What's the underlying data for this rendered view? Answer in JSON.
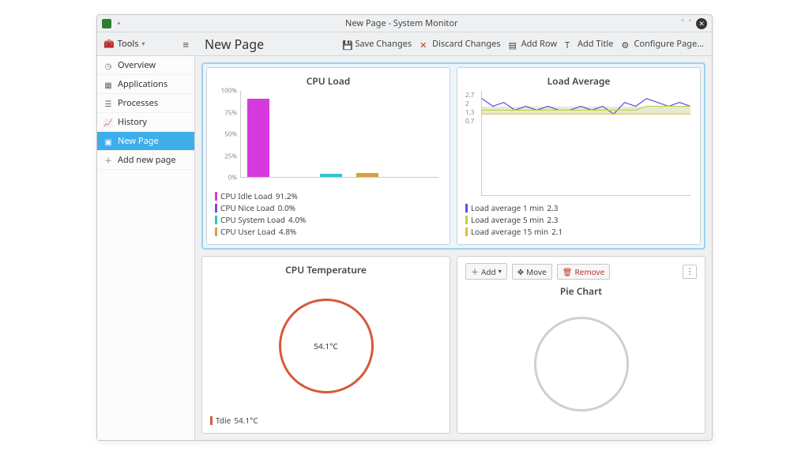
{
  "window": {
    "title": "New Page - System Monitor"
  },
  "sidebar_header": {
    "tools_label": "Tools"
  },
  "page_title": "New Page",
  "actions": {
    "save": "Save Changes",
    "discard": "Discard Changes",
    "add_row": "Add Row",
    "add_title": "Add Title",
    "configure": "Configure Page..."
  },
  "sidebar": {
    "items": [
      {
        "label": "Overview",
        "icon": "speedometer"
      },
      {
        "label": "Applications",
        "icon": "grid"
      },
      {
        "label": "Processes",
        "icon": "list"
      },
      {
        "label": "History",
        "icon": "chart"
      },
      {
        "label": "New Page",
        "icon": "page",
        "active": true
      },
      {
        "label": "Add new page",
        "icon": "plus"
      }
    ]
  },
  "panels": {
    "cpu_load": {
      "title": "CPU Load",
      "y_ticks": [
        "100%",
        "75%",
        "50%",
        "25%",
        "0%"
      ],
      "legend": [
        {
          "label": "CPU Idle Load",
          "value": "91.2%",
          "color": "#d63adf"
        },
        {
          "label": "CPU Nice Load",
          "value": "0.0%",
          "color": "#7a4bd6"
        },
        {
          "label": "CPU System Load",
          "value": "4.0%",
          "color": "#2fc7c7"
        },
        {
          "label": "CPU User Load",
          "value": "4.8%",
          "color": "#d6a23a"
        }
      ]
    },
    "load_avg": {
      "title": "Load Average",
      "y_ticks": [
        "2.7",
        "2",
        "1.3",
        "0.7"
      ],
      "legend": [
        {
          "label": "Load average 1 min",
          "value": "2.3",
          "color": "#6a4bd6"
        },
        {
          "label": "Load average 5 min",
          "value": "2.3",
          "color": "#b9d63a"
        },
        {
          "label": "Load average 15 min",
          "value": "2.1",
          "color": "#d6c23a"
        }
      ]
    },
    "cpu_temp": {
      "title": "CPU Temperature",
      "center_value": "54.1°C",
      "legend": [
        {
          "label": "Tdie",
          "value": "54.1°C",
          "color": "#d65a3a"
        }
      ]
    },
    "pie": {
      "title": "Pie Chart",
      "toolbar": {
        "add": "Add",
        "move": "Move",
        "remove": "Remove"
      }
    }
  },
  "chart_data": [
    {
      "type": "bar",
      "title": "CPU Load",
      "ylabel": "%",
      "ylim": [
        0,
        100
      ],
      "categories": [
        "CPU Idle Load",
        "CPU Nice Load",
        "CPU System Load",
        "CPU User Load"
      ],
      "values": [
        91.2,
        0.0,
        4.0,
        4.8
      ],
      "colors": [
        "#d63adf",
        "#7a4bd6",
        "#2fc7c7",
        "#d6a23a"
      ]
    },
    {
      "type": "line",
      "title": "Load Average",
      "ylim": [
        0,
        2.7
      ],
      "x": [
        0,
        1,
        2,
        3,
        4,
        5,
        6,
        7,
        8,
        9,
        10,
        11,
        12,
        13,
        14,
        15,
        16,
        17,
        18,
        19
      ],
      "series": [
        {
          "name": "Load average 1 min",
          "color": "#6a4bd6",
          "values": [
            2.5,
            2.3,
            2.4,
            2.2,
            2.3,
            2.2,
            2.3,
            2.2,
            2.2,
            2.3,
            2.2,
            2.3,
            2.1,
            2.4,
            2.3,
            2.5,
            2.4,
            2.3,
            2.4,
            2.3
          ]
        },
        {
          "name": "Load average 5 min",
          "color": "#b9d63a",
          "values": [
            2.2,
            2.2,
            2.2,
            2.2,
            2.2,
            2.2,
            2.2,
            2.2,
            2.2,
            2.2,
            2.2,
            2.2,
            2.2,
            2.2,
            2.2,
            2.3,
            2.3,
            2.3,
            2.3,
            2.3
          ]
        },
        {
          "name": "Load average 15 min",
          "color": "#d6c23a",
          "values": [
            2.1,
            2.1,
            2.1,
            2.1,
            2.1,
            2.1,
            2.1,
            2.1,
            2.1,
            2.1,
            2.1,
            2.1,
            2.1,
            2.1,
            2.1,
            2.1,
            2.1,
            2.1,
            2.1,
            2.1
          ]
        }
      ]
    },
    {
      "type": "pie",
      "title": "CPU Temperature",
      "series": [
        {
          "name": "Tdie",
          "value": 54.1,
          "unit": "°C",
          "color": "#d65a3a"
        }
      ]
    },
    {
      "type": "pie",
      "title": "Pie Chart",
      "series": []
    }
  ]
}
